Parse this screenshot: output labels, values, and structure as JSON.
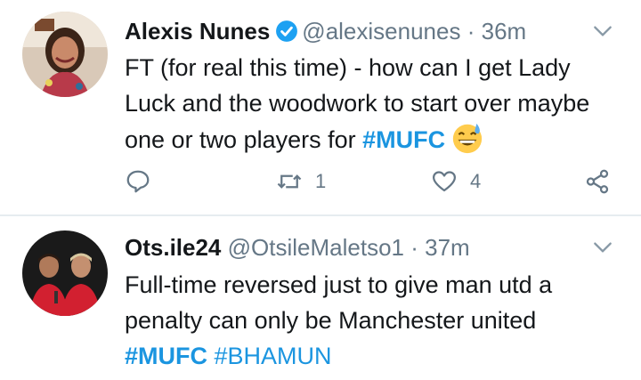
{
  "tweets": [
    {
      "name": "Alexis Nunes",
      "handle": "@alexisenunes",
      "separator": "·",
      "time": "36m",
      "verified": true,
      "text_parts": [
        {
          "text": "FT (for real this time) - how can I get Lady Luck and the woodwork to start over maybe one or two players for ",
          "type": "text"
        },
        {
          "text": "#MUFC",
          "type": "hashtag"
        }
      ],
      "emoji": "grinning-sweat-emoji",
      "retweets": "1",
      "likes": "4"
    },
    {
      "name": "Ots.ile24",
      "handle": "@OtsileMaletso1",
      "separator": "·",
      "time": "37m",
      "verified": false,
      "text_parts": [
        {
          "text": "Full-time reversed just to give man utd a penalty can only be Manchester united",
          "type": "text"
        },
        {
          "text": "#MUFC",
          "type": "hashtag"
        },
        {
          "text": "#BHAMUN",
          "type": "hashtag"
        }
      ]
    }
  ],
  "colors": {
    "link": "#1b95e0",
    "secondary": "#657786",
    "verified": "#1da1f2"
  }
}
